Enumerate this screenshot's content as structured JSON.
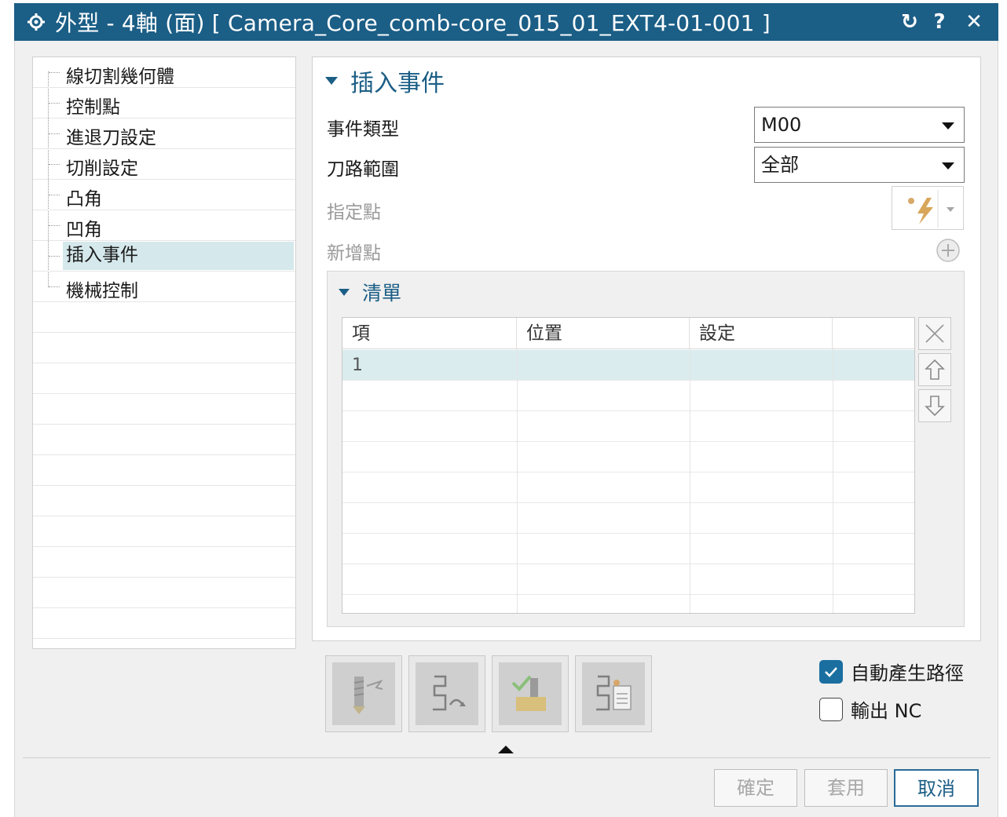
{
  "window": {
    "title": "外型 - 4軸 (面) [ Camera_Core_comb-core_015_01_EXT4-01-001 ]",
    "reset_glyph": "↻",
    "help_glyph": "?",
    "close_glyph": "✕"
  },
  "tree": {
    "items": [
      {
        "label": "線切割幾何體"
      },
      {
        "label": "控制點"
      },
      {
        "label": "進退刀設定"
      },
      {
        "label": "切削設定"
      },
      {
        "label": "凸角"
      },
      {
        "label": "凹角"
      },
      {
        "label": "插入事件",
        "selected": true
      },
      {
        "label": "機械控制"
      }
    ]
  },
  "insert_event": {
    "heading": "插入事件",
    "event_type_label": "事件類型",
    "event_type_value": "M00",
    "path_range_label": "刀路範圍",
    "path_range_value": "全部",
    "specify_point_label": "指定點",
    "add_point_label": "新增點"
  },
  "list": {
    "heading": "清單",
    "columns": [
      "項",
      "位置",
      "設定",
      ""
    ],
    "rows": [
      [
        "1",
        "",
        "",
        ""
      ]
    ]
  },
  "options": {
    "auto_generate_path_label": "自動產生路徑",
    "auto_generate_path_checked": true,
    "output_nc_label": "輸出 NC",
    "output_nc_checked": false
  },
  "buttons": {
    "ok": "確定",
    "apply": "套用",
    "cancel": "取消"
  },
  "colors": {
    "titlebar": "#1b5e86",
    "accent": "#1b5e86",
    "selection": "#d5e8ec"
  }
}
